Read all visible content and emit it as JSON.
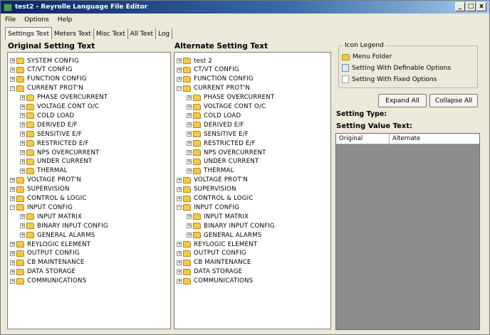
{
  "window": {
    "title": "test2 - Reyrolle Language File Editor",
    "controls": [
      "_",
      "□",
      "x"
    ]
  },
  "menu": [
    "File",
    "Options",
    "Help"
  ],
  "tabs": [
    "Settings Text",
    "Meters Text",
    "Misc Text",
    "All Text",
    "Log"
  ],
  "original_panel": {
    "heading": "Original Setting Text",
    "items": [
      {
        "label": "SYSTEM CONFIG",
        "level": 0,
        "exp": "+"
      },
      {
        "label": "CT/VT CONFIG",
        "level": 0,
        "exp": "+"
      },
      {
        "label": "FUNCTION CONFIG",
        "level": 0,
        "exp": "+"
      },
      {
        "label": "CURRENT PROT'N",
        "level": 0,
        "exp": "−"
      },
      {
        "label": "PHASE OVERCURRENT",
        "level": 1,
        "exp": "+"
      },
      {
        "label": "VOLTAGE CONT O/C",
        "level": 1,
        "exp": "+"
      },
      {
        "label": "COLD LOAD",
        "level": 1,
        "exp": "+"
      },
      {
        "label": "DERIVED E/F",
        "level": 1,
        "exp": "+"
      },
      {
        "label": "SENSITIVE E/F",
        "level": 1,
        "exp": "+"
      },
      {
        "label": "RESTRICTED E/F",
        "level": 1,
        "exp": "+"
      },
      {
        "label": "NPS OVERCURRENT",
        "level": 1,
        "exp": "+"
      },
      {
        "label": "UNDER CURRENT",
        "level": 1,
        "exp": "+"
      },
      {
        "label": "THERMAL",
        "level": 1,
        "exp": "+"
      },
      {
        "label": "VOLTAGE PROT'N",
        "level": 0,
        "exp": "+"
      },
      {
        "label": "SUPERVISION",
        "level": 0,
        "exp": "+"
      },
      {
        "label": "CONTROL & LOGIC",
        "level": 0,
        "exp": "+"
      },
      {
        "label": "INPUT CONFIG",
        "level": 0,
        "exp": "−"
      },
      {
        "label": "INPUT MATRIX",
        "level": 1,
        "exp": "+"
      },
      {
        "label": "BINARY INPUT CONFIG",
        "level": 1,
        "exp": "+"
      },
      {
        "label": "GENERAL ALARMS",
        "level": 1,
        "exp": "+"
      },
      {
        "label": "REYLOGIC ELEMENT",
        "level": 0,
        "exp": "+"
      },
      {
        "label": "OUTPUT CONFIG",
        "level": 0,
        "exp": "+"
      },
      {
        "label": "CB MAINTENANCE",
        "level": 0,
        "exp": "+"
      },
      {
        "label": "DATA STORAGE",
        "level": 0,
        "exp": "+"
      },
      {
        "label": "COMMUNICATIONS",
        "level": 0,
        "exp": "+"
      }
    ]
  },
  "alternate_panel": {
    "heading": "Alternate Setting Text",
    "items": [
      {
        "label": "test 2",
        "level": 0,
        "exp": "+"
      },
      {
        "label": "CT/VT CONFIG",
        "level": 0,
        "exp": "+"
      },
      {
        "label": "FUNCTION CONFIG",
        "level": 0,
        "exp": "+"
      },
      {
        "label": "CURRENT PROT'N",
        "level": 0,
        "exp": "−"
      },
      {
        "label": "PHASE OVERCURRENT",
        "level": 1,
        "exp": "+"
      },
      {
        "label": "VOLTAGE CONT O/C",
        "level": 1,
        "exp": "+"
      },
      {
        "label": "COLD LOAD",
        "level": 1,
        "exp": "+"
      },
      {
        "label": "DERIVED E/F",
        "level": 1,
        "exp": "+"
      },
      {
        "label": "SENSITIVE E/F",
        "level": 1,
        "exp": "+"
      },
      {
        "label": "RESTRICTED E/F",
        "level": 1,
        "exp": "+"
      },
      {
        "label": "NPS OVERCURRENT",
        "level": 1,
        "exp": "+"
      },
      {
        "label": "UNDER CURRENT",
        "level": 1,
        "exp": "+"
      },
      {
        "label": "THERMAL",
        "level": 1,
        "exp": "+"
      },
      {
        "label": "VOLTAGE PROT'N",
        "level": 0,
        "exp": "+"
      },
      {
        "label": "SUPERVISION",
        "level": 0,
        "exp": "+"
      },
      {
        "label": "CONTROL & LOGIC",
        "level": 0,
        "exp": "+"
      },
      {
        "label": "INPUT CONFIG",
        "level": 0,
        "exp": "−"
      },
      {
        "label": "INPUT MATRIX",
        "level": 1,
        "exp": "+"
      },
      {
        "label": "BINARY INPUT CONFIG",
        "level": 1,
        "exp": "+"
      },
      {
        "label": "GENERAL ALARMS",
        "level": 1,
        "exp": "+"
      },
      {
        "label": "REYLOGIC ELEMENT",
        "level": 0,
        "exp": "+"
      },
      {
        "label": "OUTPUT CONFIG",
        "level": 0,
        "exp": "+"
      },
      {
        "label": "CB MAINTENANCE",
        "level": 0,
        "exp": "+"
      },
      {
        "label": "DATA STORAGE",
        "level": 0,
        "exp": "+"
      },
      {
        "label": "COMMUNICATIONS",
        "level": 0,
        "exp": "+"
      }
    ]
  },
  "legend": {
    "title": "Icon Legend",
    "menu_folder": "Menu Folder",
    "definable": "Setting With Definable Options",
    "fixed": "Setting With Fixed Options"
  },
  "buttons": {
    "expand_all": "Expand All",
    "collapse_all": "Collapse All"
  },
  "labels": {
    "setting_type": "Setting Type:",
    "setting_value_text": "Setting Value Text:"
  },
  "value_table": {
    "columns": [
      "Original",
      "Alternate"
    ]
  }
}
